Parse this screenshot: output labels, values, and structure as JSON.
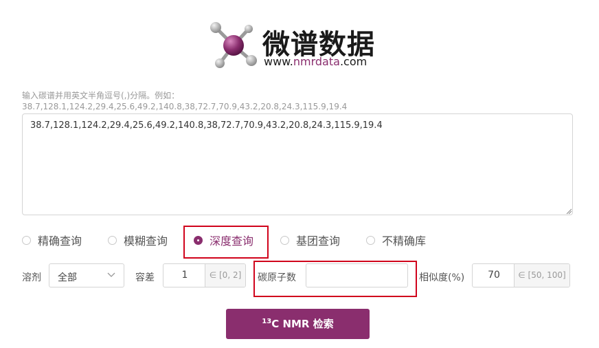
{
  "logo": {
    "title": "微谱数据",
    "url_prefix": "www.",
    "url_highlight": "nmrdata",
    "url_suffix": ".com",
    "icon": "molecule-logo-icon"
  },
  "hint": {
    "line1": "输入碳谱并用英文半角逗号(,)分隔。例如：",
    "line2": "38.7,128.1,124.2,29.4,25.6,49.2,140.8,38,72.7,70.9,43.2,20.8,24.3,115.9,19.4"
  },
  "textarea": {
    "value": "38.7,128.1,124.2,29.4,25.6,49.2,140.8,38,72.7,70.9,43.2,20.8,24.3,115.9,19.4"
  },
  "search_modes": [
    {
      "label": "精确查询",
      "selected": false
    },
    {
      "label": "模糊查询",
      "selected": false
    },
    {
      "label": "深度查询",
      "selected": true
    },
    {
      "label": "基团查询",
      "selected": false
    },
    {
      "label": "不精确库",
      "selected": false
    }
  ],
  "filters": {
    "solvent_label": "溶剂",
    "solvent_value": "全部",
    "tolerance_label": "容差",
    "tolerance_value": "1",
    "tolerance_range": "∈ [0, 2]",
    "carbon_count_label": "碳原子数",
    "carbon_count_value": "",
    "similarity_label": "相似度(%)",
    "similarity_value": "70",
    "similarity_range": "∈ [50, 100]"
  },
  "search_button": {
    "sup": "13",
    "label": "C NMR 检索"
  },
  "colors": {
    "brand": "#8a2e6e",
    "highlight": "#d0021b"
  }
}
